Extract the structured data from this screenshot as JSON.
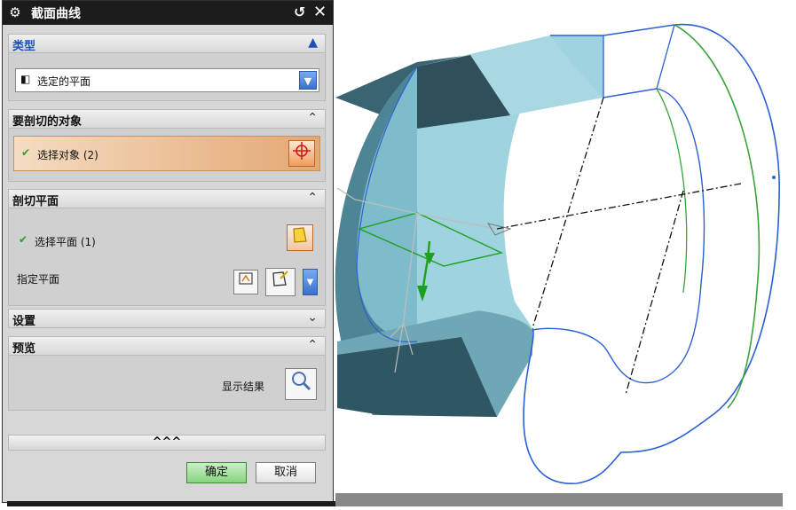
{
  "dialog": {
    "title": "截面曲线",
    "title_icon": "gear-icon",
    "reset_icon": "reset-icon",
    "close_icon": "close-icon",
    "sections": {
      "type": {
        "label": "类型",
        "chevron": "^",
        "selected_option": "选定的平面",
        "option_icon": "plane-icon"
      },
      "objects": {
        "label": "要剖切的对象",
        "chevron": "^",
        "row_label": "选择对象 (2)",
        "select_icon": "crosshair-icon"
      },
      "plane": {
        "label": "剖切平面",
        "chevron": "^",
        "row_label": "选择平面 (1)",
        "specify_label": "指定平面"
      },
      "settings": {
        "label": "设置",
        "chevron": "v"
      },
      "preview": {
        "label": "预览",
        "chevron": "^",
        "show_result_label": "显示结果"
      }
    },
    "more_label": "^^^",
    "ok_label": "确定",
    "cancel_label": "取消"
  },
  "colors": {
    "accent_blue": "#1f4fb8",
    "face_cyan": "#9fd3df",
    "edge_blue": "#2b5fd6",
    "edge_green": "#3aa33a",
    "selected_orange": "#e3a873"
  }
}
